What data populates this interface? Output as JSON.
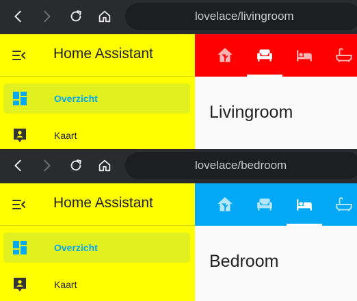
{
  "colors": {
    "sidebar_bg": "#ffff00",
    "active_item_bg": "#e3f020",
    "active_accent": "#03a9f4",
    "livingroom_toolbar": "#ff0000",
    "bedroom_toolbar": "#03a9f4",
    "browser_bar": "#2a2b2e",
    "content_bg": "#fafafa"
  },
  "screens": [
    {
      "url": "lovelace/livingroom",
      "app_title": "Home Assistant",
      "nav_items": [
        {
          "label": "Overzicht",
          "icon": "dashboard-icon",
          "active": true
        },
        {
          "label": "Kaart",
          "icon": "map-icon",
          "active": false
        }
      ],
      "tabs": [
        {
          "icon": "home-icon",
          "active": false
        },
        {
          "icon": "sofa-icon",
          "active": true
        },
        {
          "icon": "bed-icon",
          "active": false
        },
        {
          "icon": "bathtub-icon",
          "active": false
        }
      ],
      "view_title": "Livingroom"
    },
    {
      "url": "lovelace/bedroom",
      "app_title": "Home Assistant",
      "nav_items": [
        {
          "label": "Overzicht",
          "icon": "dashboard-icon",
          "active": true
        },
        {
          "label": "Kaart",
          "icon": "map-icon",
          "active": false
        }
      ],
      "tabs": [
        {
          "icon": "home-icon",
          "active": false
        },
        {
          "icon": "sofa-icon",
          "active": false
        },
        {
          "icon": "bed-icon",
          "active": true
        },
        {
          "icon": "bathtub-icon",
          "active": false
        }
      ],
      "view_title": "Bedroom"
    }
  ]
}
